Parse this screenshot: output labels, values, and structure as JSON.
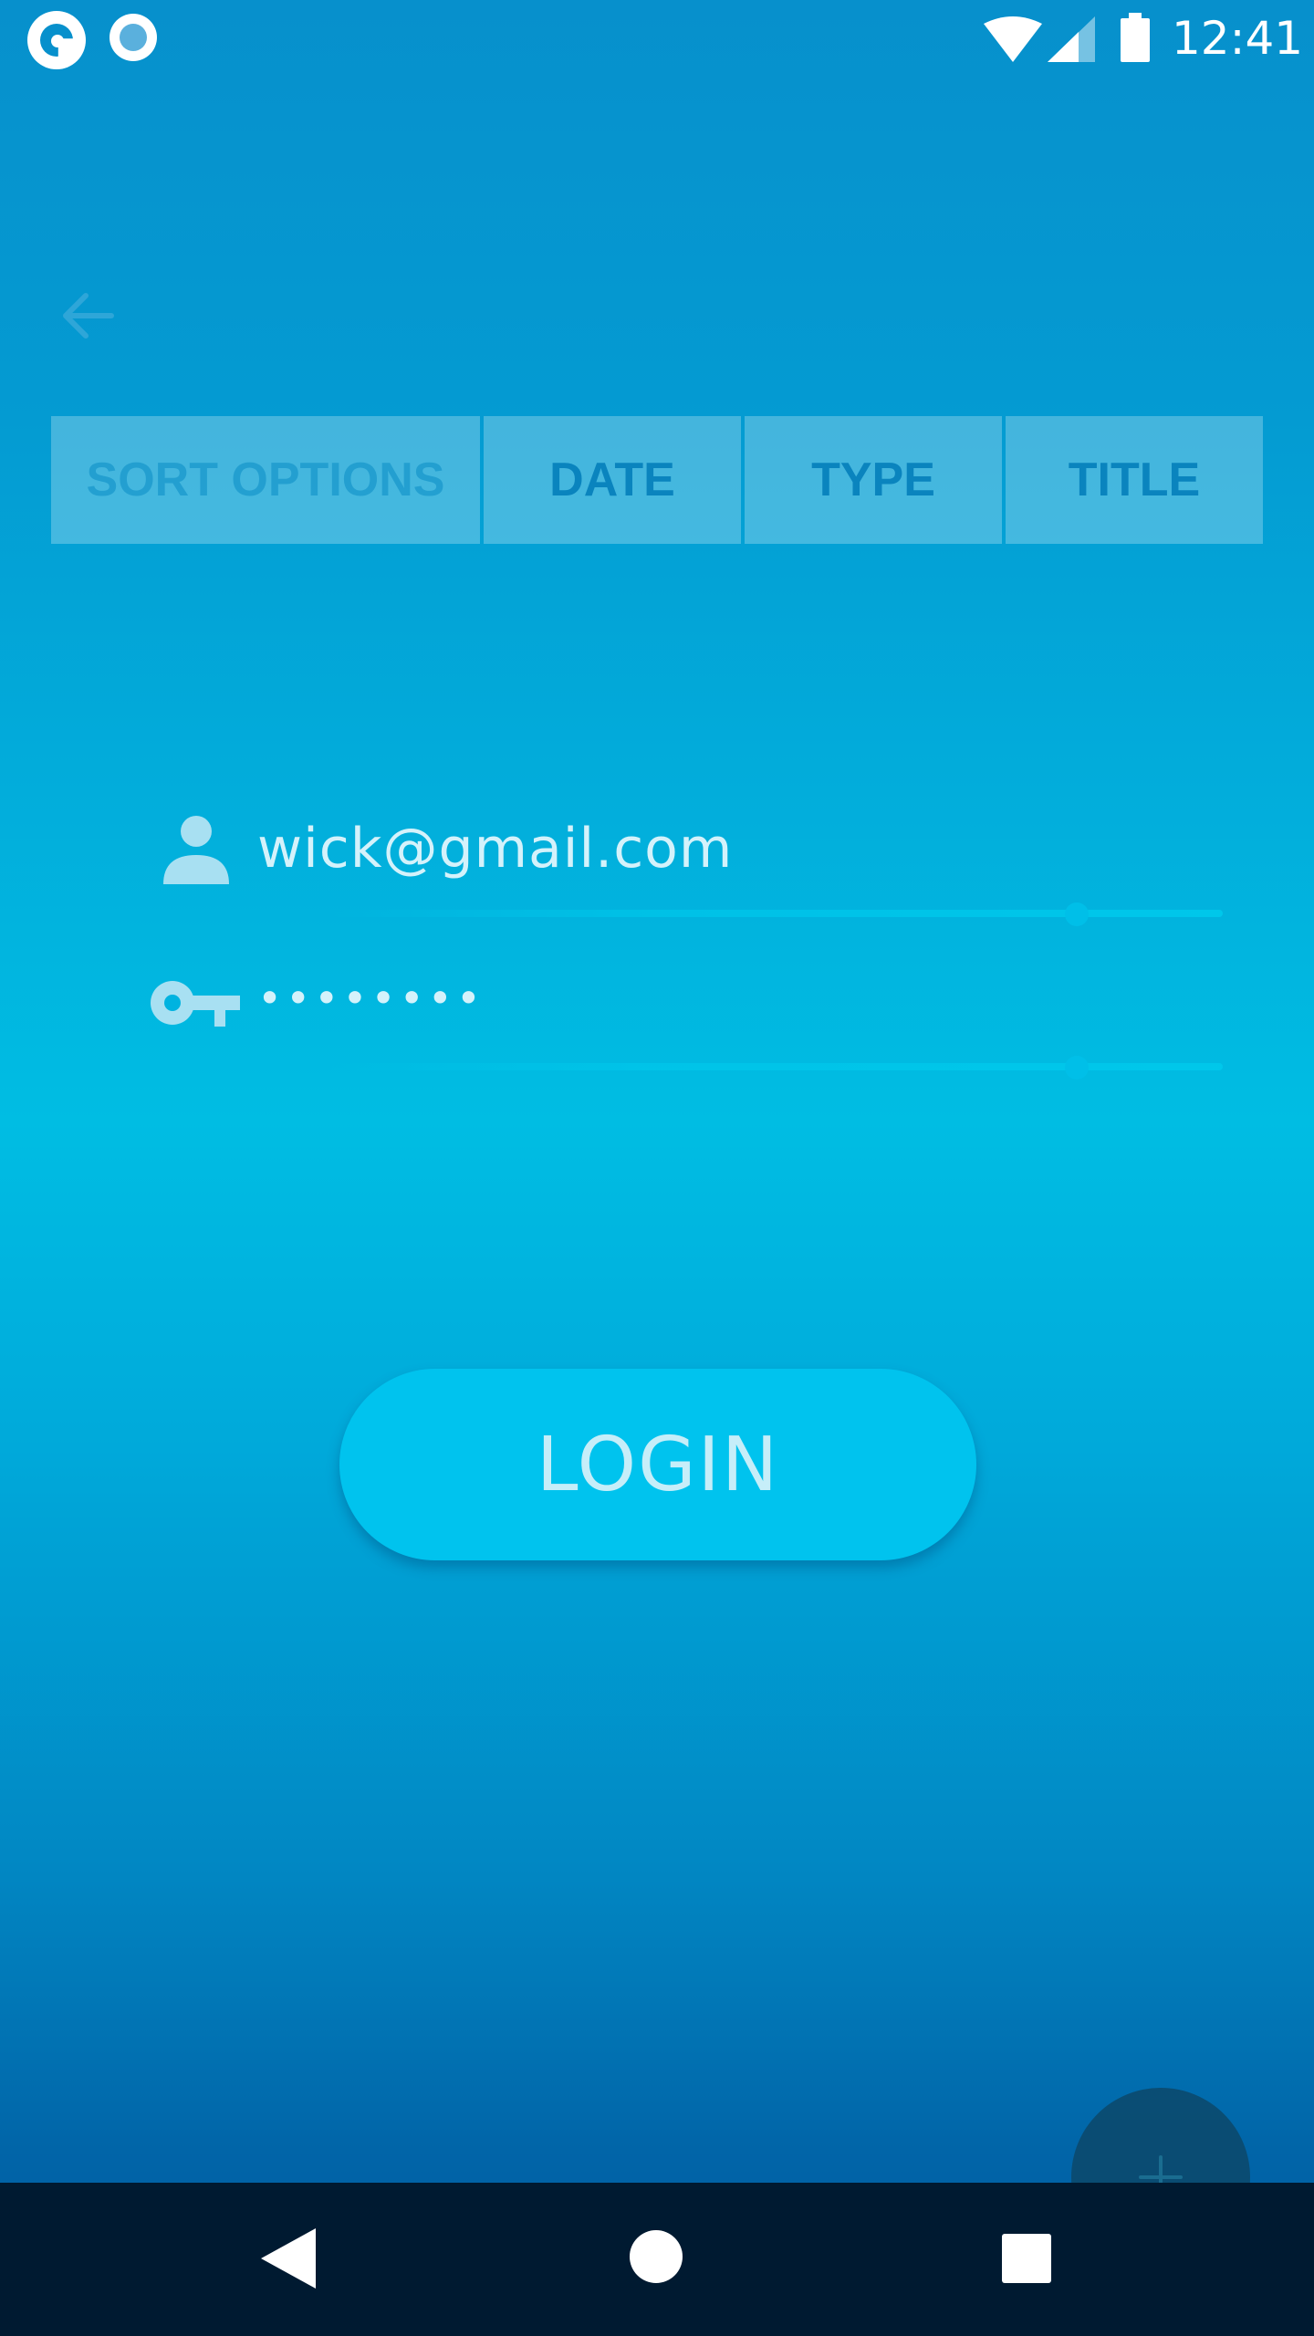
{
  "status_bar": {
    "time": "12:41",
    "icons": [
      "app-notification-icon",
      "record-icon",
      "wifi-icon",
      "signal-icon",
      "battery-icon"
    ]
  },
  "toolbar": {
    "back_icon": "arrow-left-icon"
  },
  "sort_bar": {
    "label": "SORT OPTIONS",
    "options": [
      "DATE",
      "TYPE",
      "TITLE"
    ]
  },
  "login_form": {
    "email": {
      "icon": "person-icon",
      "value": "wick@gmail.com"
    },
    "password": {
      "icon": "key-icon",
      "value": "••••••••"
    },
    "login_label": "LOGIN"
  },
  "fab": {
    "icon": "plus-icon"
  },
  "nav_bar": {
    "icons": [
      "nav-back-icon",
      "nav-home-icon",
      "nav-recents-icon"
    ]
  },
  "colors": {
    "gradient_top": "#0790cc",
    "gradient_mid": "#00bde3",
    "gradient_bottom": "#0158a0",
    "button": "#00c3ee",
    "nav_bar": "#001a31",
    "sort_text": "#0a84be"
  }
}
